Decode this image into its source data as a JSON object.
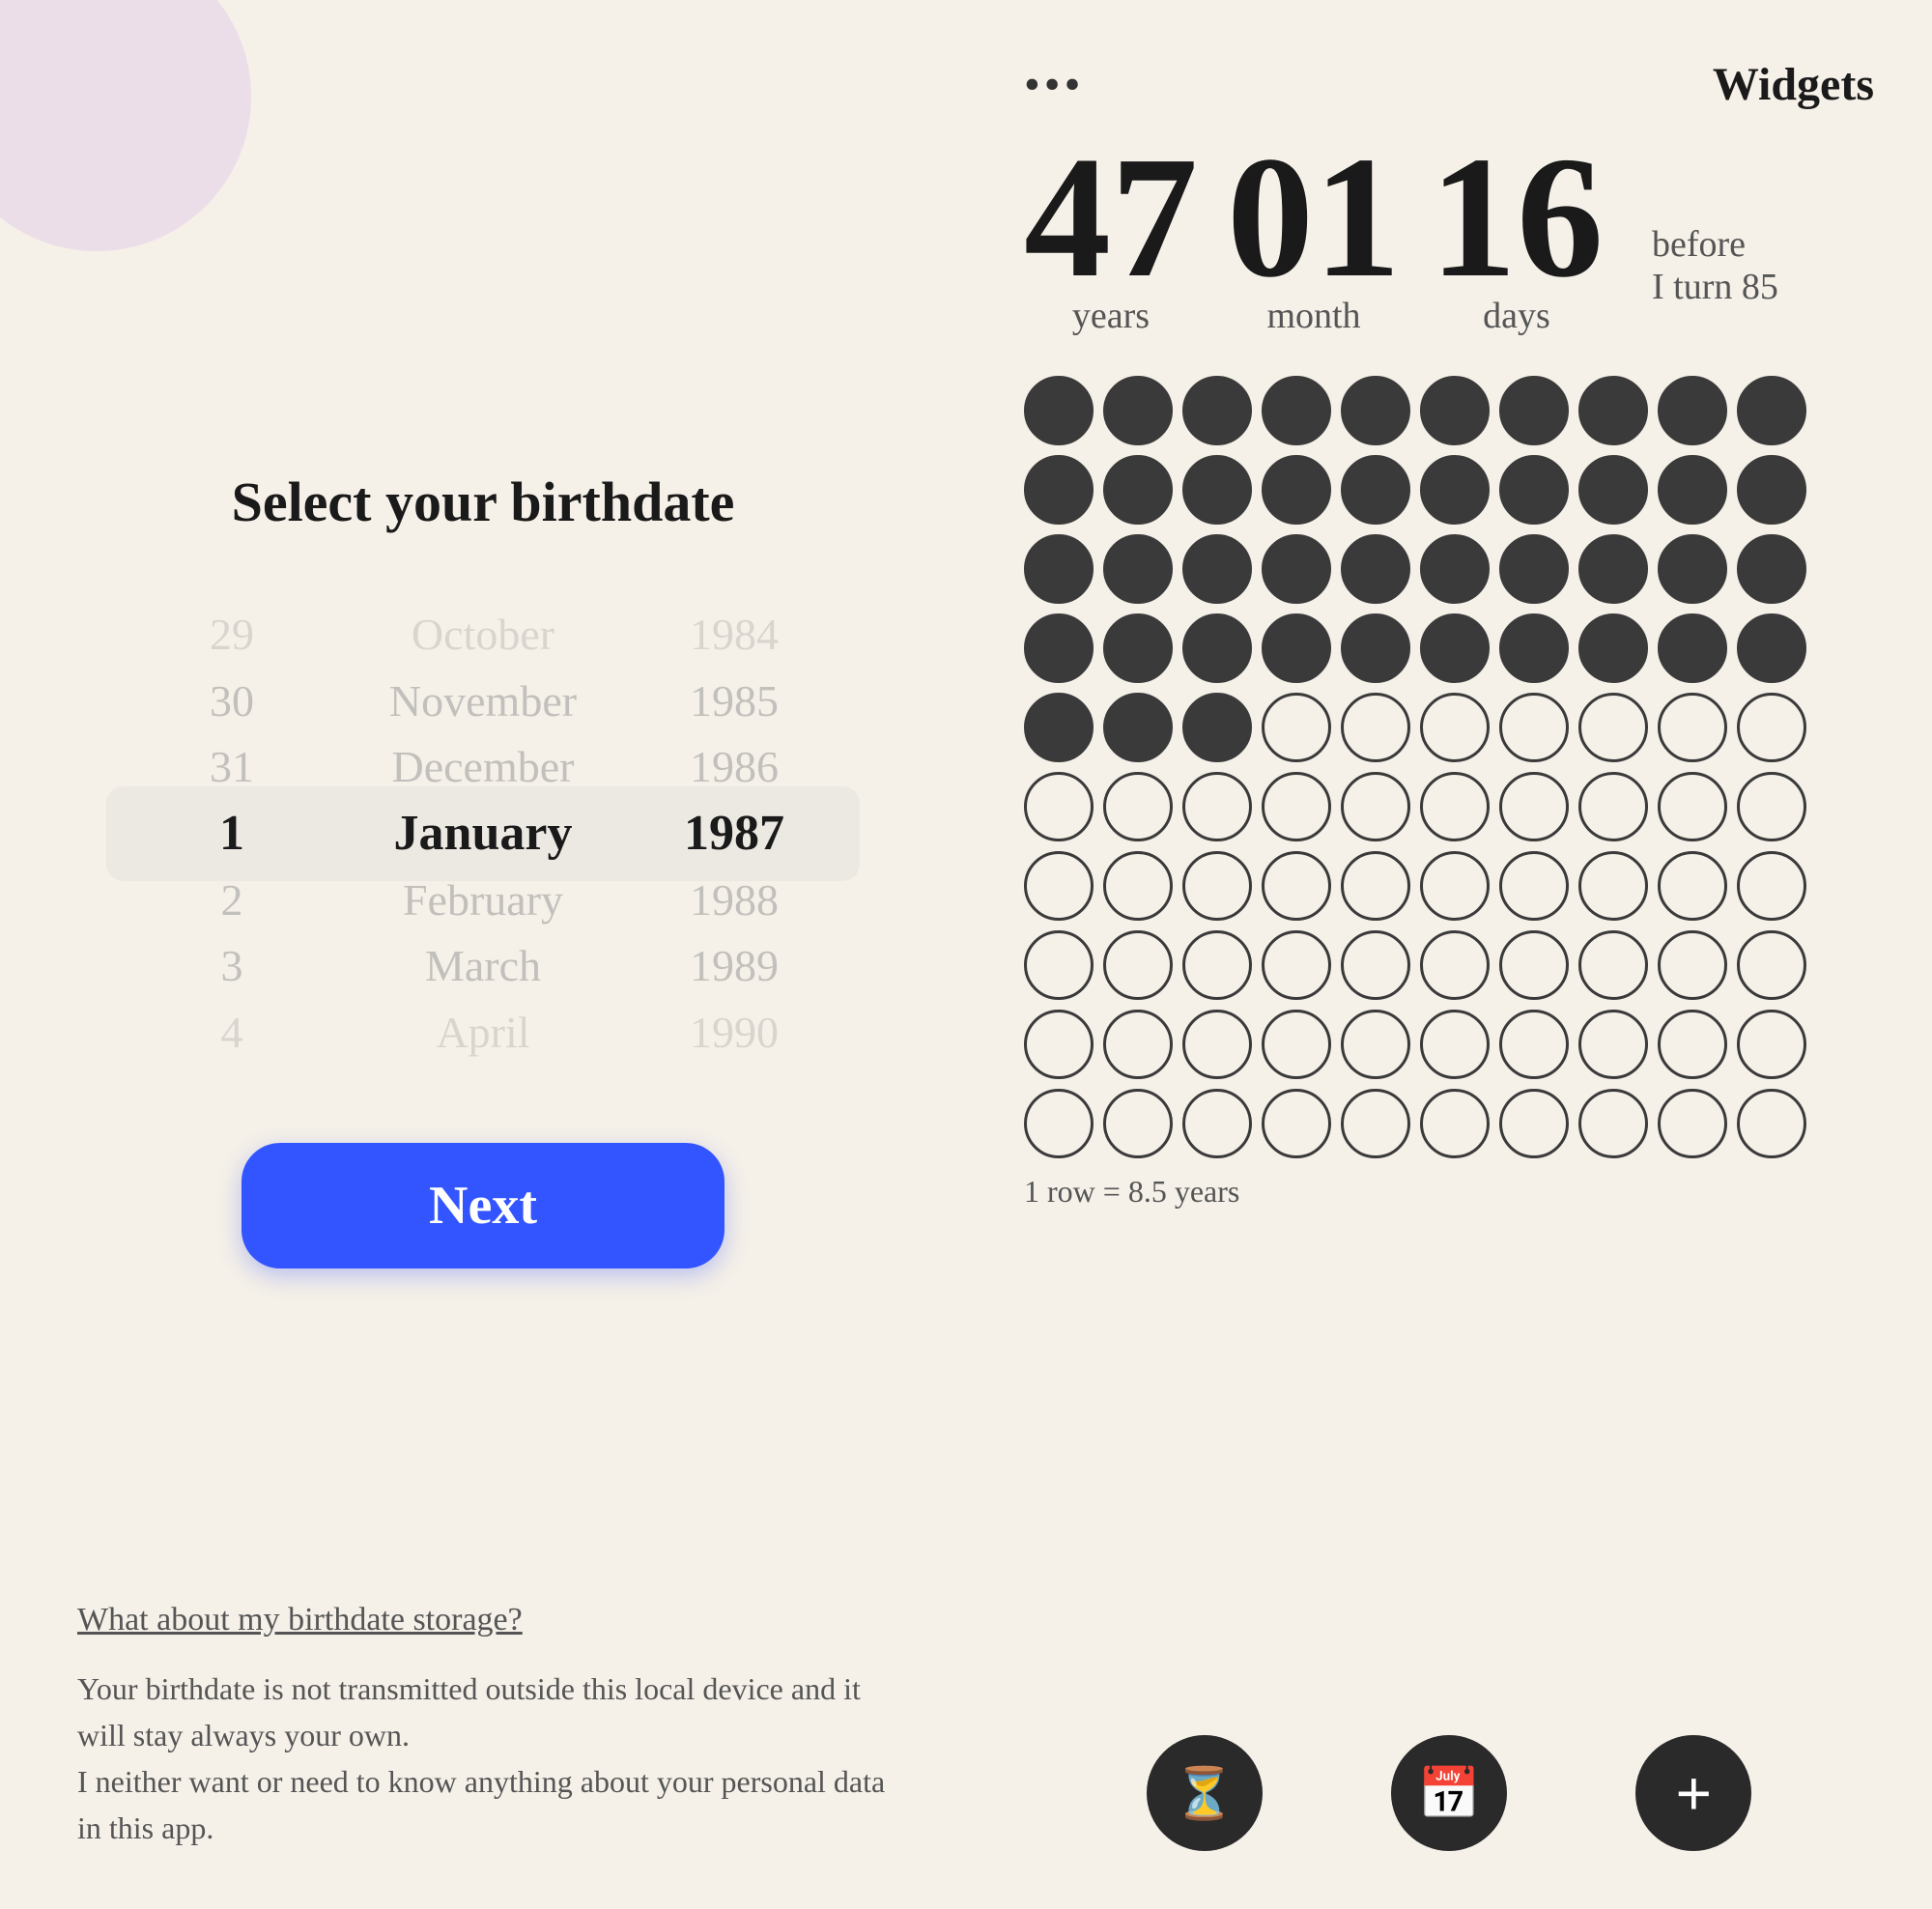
{
  "left": {
    "title": "Select your birthdate",
    "picker": {
      "days": [
        {
          "value": "29",
          "state": "faded-2"
        },
        {
          "value": "30",
          "state": "faded-1"
        },
        {
          "value": "31",
          "state": "faded-1"
        },
        {
          "value": "1",
          "state": "selected"
        },
        {
          "value": "2",
          "state": "faded-1"
        },
        {
          "value": "3",
          "state": "faded-1"
        },
        {
          "value": "4",
          "state": "faded-2"
        }
      ],
      "months": [
        {
          "value": "October",
          "state": "faded-2"
        },
        {
          "value": "November",
          "state": "faded-1"
        },
        {
          "value": "December",
          "state": "faded-1"
        },
        {
          "value": "January",
          "state": "selected"
        },
        {
          "value": "February",
          "state": "faded-1"
        },
        {
          "value": "March",
          "state": "faded-1"
        },
        {
          "value": "April",
          "state": "faded-2"
        }
      ],
      "years": [
        {
          "value": "1984",
          "state": "faded-2"
        },
        {
          "value": "1985",
          "state": "faded-1"
        },
        {
          "value": "1986",
          "state": "faded-1"
        },
        {
          "value": "1987",
          "state": "selected"
        },
        {
          "value": "1988",
          "state": "faded-1"
        },
        {
          "value": "1989",
          "state": "faded-1"
        },
        {
          "value": "1990",
          "state": "faded-2"
        }
      ]
    },
    "next_button": "Next",
    "storage_link": "What about my birthdate storage?",
    "storage_text": "Your birthdate is not transmitted outside this local device and it will stay always your own.\nI neither want or need to know anything about your personal data in this app."
  },
  "right": {
    "menu_dots": "•••",
    "widgets_label": "Widgets",
    "countdown": {
      "years_value": "47",
      "years_label": "years",
      "months_value": "01",
      "months_label": "month",
      "days_value": "16",
      "days_label": "days",
      "before_text": "before",
      "turn_text": "I turn 85"
    },
    "dot_grid": {
      "rows": 10,
      "cols": 10,
      "filled_rows": 4,
      "partial_row": 3,
      "row_label": "1 row = 8.5 years"
    },
    "nav": {
      "timer_icon": "⏳",
      "calendar_icon": "📅",
      "plus_icon": "+"
    }
  }
}
